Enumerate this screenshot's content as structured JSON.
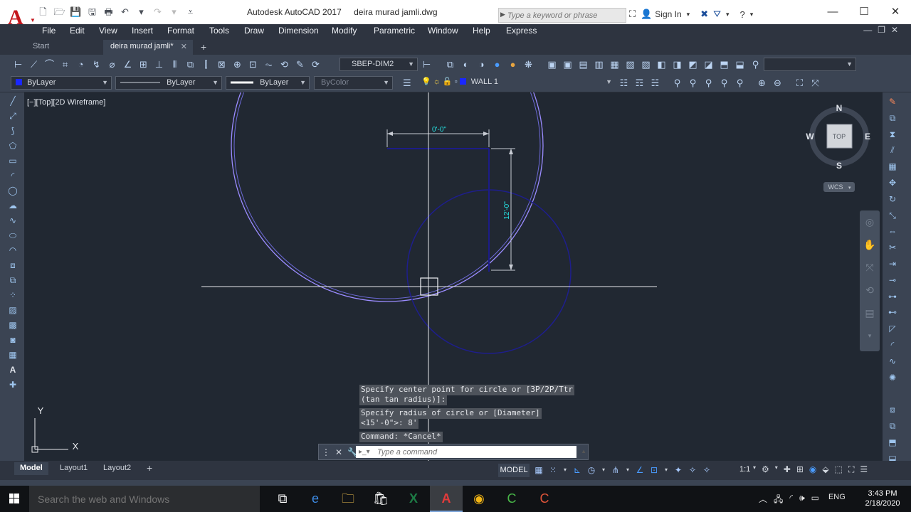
{
  "app": {
    "logo_letter": "A",
    "title": "Autodesk AutoCAD 2017",
    "filename": "deira murad jamli.dwg"
  },
  "search": {
    "placeholder": "Type a keyword or phrase"
  },
  "account": {
    "signin_label": "Sign In"
  },
  "menu": [
    "File",
    "Edit",
    "View",
    "Insert",
    "Format",
    "Tools",
    "Draw",
    "Dimension",
    "Modify",
    "Parametric",
    "Window",
    "Help",
    "Express"
  ],
  "tabs": {
    "start": "Start",
    "document": "deira murad jamli*",
    "close_glyph": "✕",
    "new_glyph": "+"
  },
  "toolbar": {
    "dimstyle": "SBEP-DIM2",
    "color": "ByLayer",
    "linetype": "ByLayer",
    "lineweight": "ByLayer",
    "plotstyle": "ByColor",
    "layer": "WALL 1"
  },
  "viewport": {
    "label": "[−][Top][2D Wireframe]",
    "viewcube": {
      "north": "N",
      "south": "S",
      "east": "E",
      "west": "W",
      "face": "TOP",
      "wcs": "WCS"
    },
    "dims": {
      "horizontal": "0'-0\"",
      "vertical": "12'-0\""
    },
    "ucs": {
      "x": "X",
      "y": "Y"
    }
  },
  "command": {
    "history": [
      "Specify center point for circle or [3P/2P/Ttr",
      "(tan tan radius)]:",
      "Specify radius of circle or [Diameter]",
      "<15'-0\">: 8'",
      "Command: *Cancel*"
    ],
    "placeholder": "Type a command"
  },
  "layouts": {
    "model": "Model",
    "layout1": "Layout1",
    "layout2": "Layout2",
    "add": "+"
  },
  "status": {
    "space": "MODEL",
    "scale": "1:1"
  },
  "taskbar": {
    "search_placeholder": "Search the web and Windows",
    "language": "ENG",
    "time": "3:43 PM",
    "date": "2/18/2020"
  },
  "colors": {
    "accent_red": "#c4161c",
    "bylayer_blue": "#1a27ff",
    "circle_large": "#9b8cff",
    "circle_small": "#1e1e8c",
    "dimension_cyan": "#26e6e6"
  }
}
